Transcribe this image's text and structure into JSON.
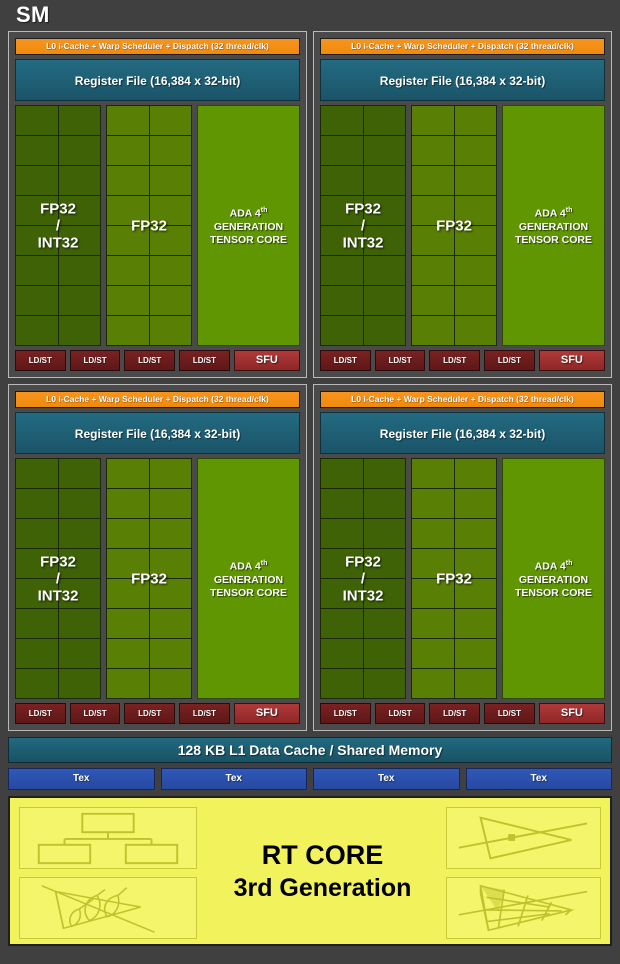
{
  "title": "SM",
  "partition": {
    "l0_label": "L0 i-Cache + Warp Scheduler + Dispatch (32 thread/clk)",
    "register_file_label": "Register File (16,384 x 32-bit)",
    "fp32_int32_label": "FP32\n/\nINT32",
    "fp32_label": "FP32",
    "tensor_core": {
      "line1_prefix": "ADA 4",
      "line1_sup": "th",
      "line2": "GENERATION",
      "line3": "TENSOR CORE"
    },
    "ldst_label": "LD/ST",
    "sfu_label": "SFU",
    "fp32_int32_cores": 16,
    "fp32_cores": 16,
    "ldst_units": 4,
    "sfu_units": 1
  },
  "partitions_count": 4,
  "l1_cache": {
    "label": "128 KB L1 Data Cache / Shared Memory"
  },
  "tex": {
    "label": "Tex",
    "count": 4
  },
  "rt_core": {
    "line1": "RT CORE",
    "line2": "3rd Generation",
    "icons": [
      "bvh-tree-icon",
      "ray-triangle-intersection-icon",
      "alpha-test-foliage-icon",
      "opacity-micromap-icon"
    ]
  },
  "colors": {
    "background": "#404040",
    "l0_bar": "#f7941e",
    "register_file": "#236b82",
    "fp32_int32_core": "#3f6207",
    "fp32_core": "#5a7f05",
    "tensor_core": "#5f9602",
    "ldst": "#7a2222",
    "sfu": "#b03a3a",
    "l1_cache": "#216a7f",
    "tex": "#2f58b8",
    "rt_core": "#f2f25c"
  }
}
